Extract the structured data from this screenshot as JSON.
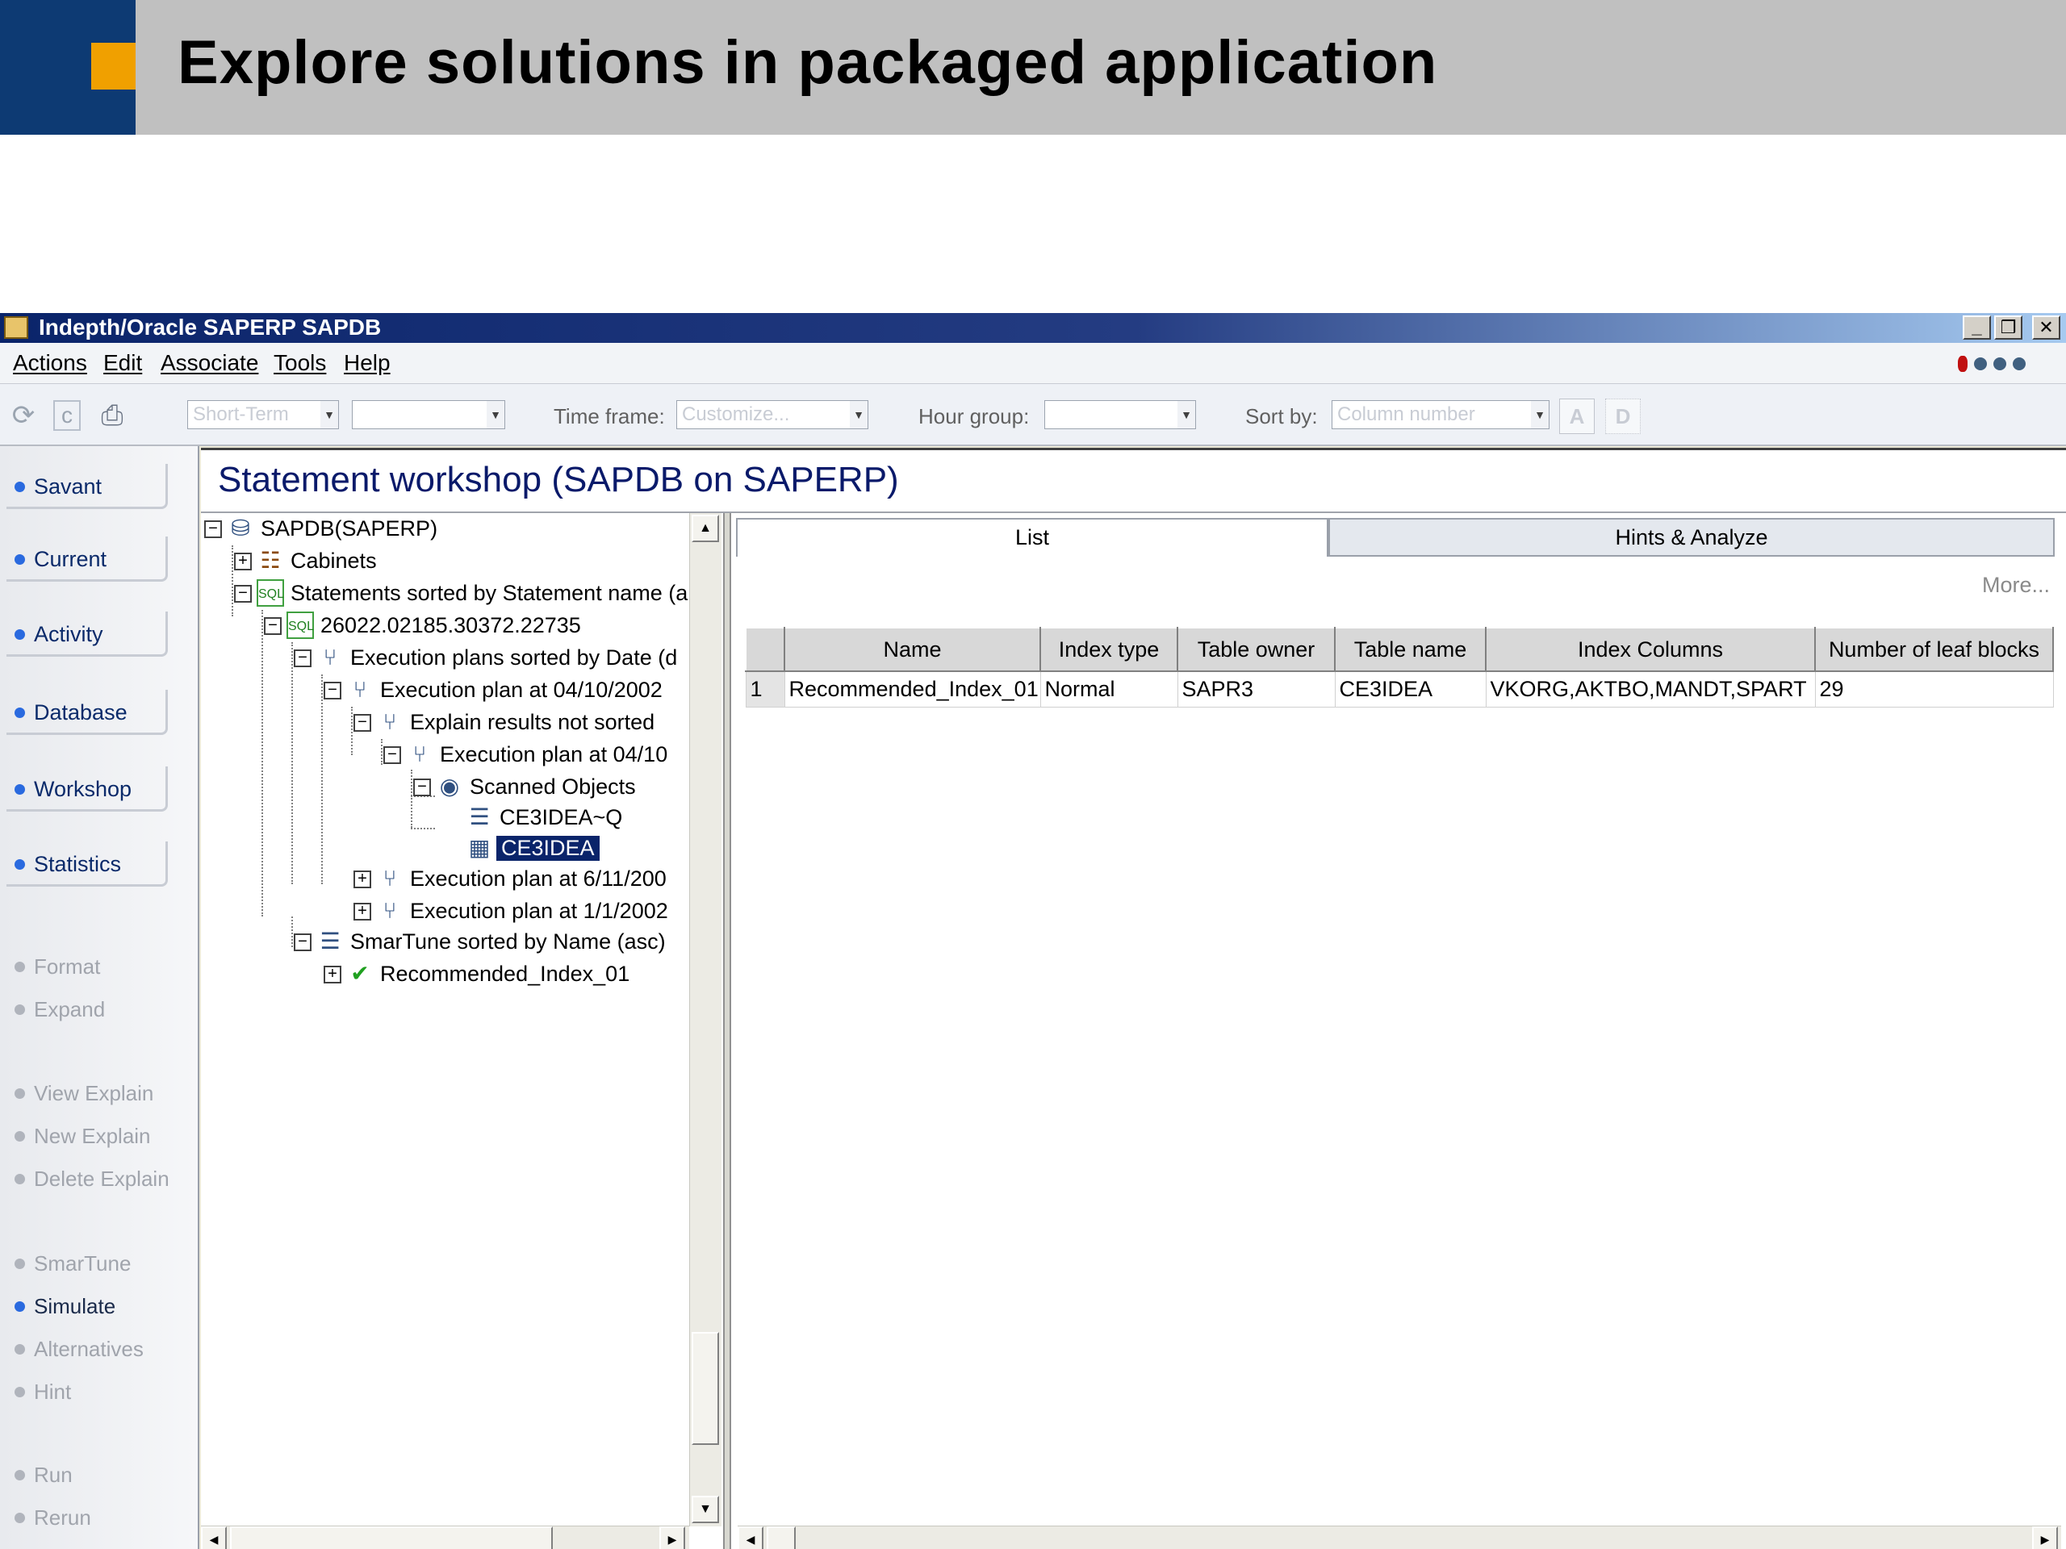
{
  "slide": {
    "title": "Explore solutions in packaged application"
  },
  "window": {
    "title": "Indepth/Oracle SAPERP SAPDB",
    "controls": {
      "minimize": "_",
      "restore": "❒",
      "close": "✕"
    }
  },
  "menu": {
    "items": [
      "Actions",
      "Edit",
      "Associate",
      "Tools",
      "Help"
    ]
  },
  "toolbar": {
    "period_combo": "Short-Term",
    "second_combo": "",
    "time_frame_label": "Time frame:",
    "time_frame_value": "Customize...",
    "hour_group_label": "Hour group:",
    "hour_group_value": "",
    "sort_by_label": "Sort by:",
    "sort_by_value": "Column number",
    "asc_button": "A",
    "desc_button": "D"
  },
  "leftnav": {
    "buttons": [
      "Savant",
      "Current",
      "Activity",
      "Database",
      "Workshop",
      "Statistics"
    ],
    "links": [
      {
        "label": "Format",
        "active": false
      },
      {
        "label": "Expand",
        "active": false
      },
      {
        "label": "View Explain",
        "active": false
      },
      {
        "label": "New Explain",
        "active": false
      },
      {
        "label": "Delete Explain",
        "active": false
      },
      {
        "label": "SmarTune",
        "active": false
      },
      {
        "label": "Simulate",
        "active": true
      },
      {
        "label": "Alternatives",
        "active": false
      },
      {
        "label": "Hint",
        "active": false
      },
      {
        "label": "Run",
        "active": false
      },
      {
        "label": "Rerun",
        "active": false
      }
    ]
  },
  "main": {
    "title": "Statement workshop (SAPDB on SAPERP)"
  },
  "tree": {
    "nodes": [
      {
        "label": "SAPDB(SAPERP)",
        "icon": "database-icon",
        "toggle": "−"
      },
      {
        "label": "Cabinets",
        "icon": "cabinet-icon",
        "toggle": "+"
      },
      {
        "label": "Statements sorted by Statement name (a",
        "icon": "sql-icon",
        "toggle": "−"
      },
      {
        "label": "26022.02185.30372.22735",
        "icon": "sql-icon",
        "toggle": "−"
      },
      {
        "label": "Execution plans sorted by Date (d",
        "icon": "plan-tree-icon",
        "toggle": "−"
      },
      {
        "label": "Execution plan at 04/10/2002",
        "icon": "plan-tree-icon",
        "toggle": "−"
      },
      {
        "label": "Explain results not sorted",
        "icon": "plan-tree-icon",
        "toggle": "−"
      },
      {
        "label": "Execution plan at 04/10",
        "icon": "plan-tree-icon",
        "toggle": "−"
      },
      {
        "label": "Scanned Objects",
        "icon": "scanned-objects-icon",
        "toggle": "−"
      },
      {
        "label": "CE3IDEA~Q",
        "icon": "index-icon",
        "toggle": ""
      },
      {
        "label": "CE3IDEA",
        "icon": "table-icon",
        "toggle": ""
      },
      {
        "label": "Execution plan at 6/11/200",
        "icon": "plan-tree-icon",
        "toggle": "+"
      },
      {
        "label": "Execution plan at 1/1/2002",
        "icon": "plan-tree-icon",
        "toggle": "+"
      },
      {
        "label": "SmarTune sorted by Name (asc)",
        "icon": "smartune-icon",
        "toggle": "−"
      },
      {
        "label": "Recommended_Index_01",
        "icon": "recommended-index-icon",
        "toggle": "+"
      }
    ]
  },
  "tabs": {
    "list": "List",
    "hints": "Hints & Analyze"
  },
  "more_link": "More...",
  "grid": {
    "columns": [
      "Name",
      "Index type",
      "Table owner",
      "Table name",
      "Index Columns",
      "Number of leaf blocks"
    ],
    "rows": [
      {
        "num": "1",
        "cells": [
          "Recommended_Index_01",
          "Normal",
          "SAPR3",
          "CE3IDEA",
          "VKORG,AKTBO,MANDT,SPART",
          "29"
        ]
      }
    ]
  }
}
